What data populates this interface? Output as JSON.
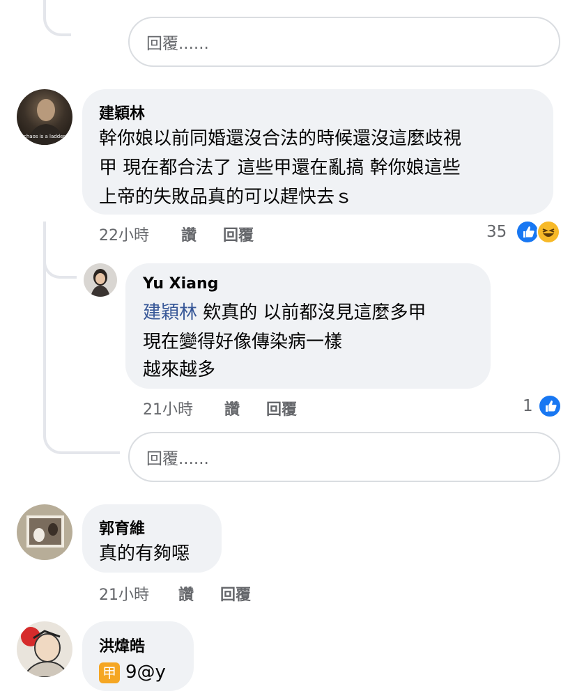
{
  "reply_placeholder": "回覆......",
  "comments": [
    {
      "author": "建穎林",
      "lines": [
        "幹你娘以前同婚還沒合法的時候還沒這麼歧視",
        "甲  現在都合法了  這些甲還在亂搞  幹你娘這些",
        "上帝的失敗品真的可以趕快去ｓ"
      ],
      "time": "22小時",
      "like_label": "讚",
      "reply_label": "回覆",
      "reaction_count": "35",
      "avatar_caption": "chaos is a ladder"
    },
    {
      "author": "Yu Xiang",
      "mention": "建穎林",
      "lines": [
        "欸真的 以前都沒見這麼多甲",
        "現在變得好像傳染病一樣",
        "越來越多"
      ],
      "time": "21小時",
      "like_label": "讚",
      "reply_label": "回覆",
      "reaction_count": "1"
    },
    {
      "author": "郭育維",
      "lines": [
        "真的有夠噁"
      ],
      "time": "21小時",
      "like_label": "讚",
      "reply_label": "回覆"
    },
    {
      "author": "洪煒皓",
      "sticker_char": "甲",
      "text": "9@y"
    }
  ],
  "colors": {
    "bubble": "#f0f2f5",
    "link": "#385898",
    "like": "#1877f2",
    "meta": "#65676b"
  },
  "icons": [
    "like-icon",
    "haha-icon"
  ]
}
